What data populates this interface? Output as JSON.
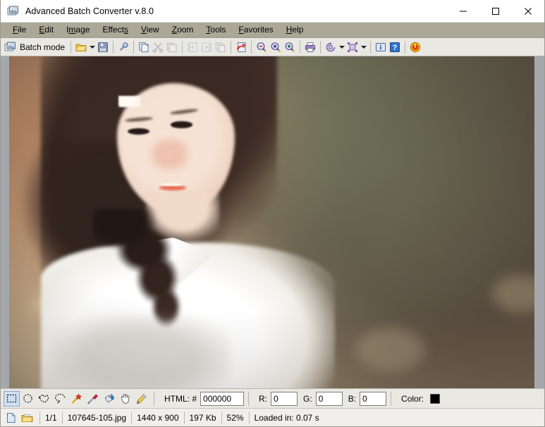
{
  "window": {
    "title": "Advanced Batch Converter v.8.0",
    "app_icon": "app-image-stack-icon",
    "controls": {
      "minimize": "minimize-icon",
      "maximize": "maximize-icon",
      "close": "close-icon"
    }
  },
  "menubar": {
    "items": [
      {
        "label": "File",
        "mnemonic": "F"
      },
      {
        "label": "Edit",
        "mnemonic": "E"
      },
      {
        "label": "Image",
        "mnemonic": "m"
      },
      {
        "label": "Effects",
        "mnemonic": "s"
      },
      {
        "label": "View",
        "mnemonic": "V"
      },
      {
        "label": "Zoom",
        "mnemonic": "Z"
      },
      {
        "label": "Tools",
        "mnemonic": "T"
      },
      {
        "label": "Favorites",
        "mnemonic": "F"
      },
      {
        "label": "Help",
        "mnemonic": "H"
      }
    ]
  },
  "toolbar": {
    "batch_mode_label": "Batch mode",
    "buttons": [
      {
        "name": "batch-mode-button",
        "icon": "image-stack-icon",
        "label": "Batch mode",
        "enabled": true
      },
      {
        "name": "open-file-button",
        "icon": "open-folder-icon",
        "label": "Open",
        "enabled": true
      },
      {
        "name": "open-dropdown",
        "icon": "chevron-down-icon",
        "label": "",
        "enabled": true
      },
      {
        "name": "save-button",
        "icon": "floppy-save-icon",
        "label": "Save",
        "enabled": true
      },
      {
        "name": "properties-button",
        "icon": "magnifier-info-icon",
        "label": "Properties",
        "enabled": true
      },
      {
        "name": "copy-button",
        "icon": "copy-icon",
        "label": "Copy",
        "enabled": true
      },
      {
        "name": "cut-button",
        "icon": "scissors-icon",
        "label": "Cut",
        "enabled": false
      },
      {
        "name": "paste-button",
        "icon": "paste-icon",
        "label": "Paste",
        "enabled": false
      },
      {
        "name": "previous-image",
        "icon": "prev-image-icon",
        "label": "Previous",
        "enabled": false
      },
      {
        "name": "next-image",
        "icon": "next-image-icon",
        "label": "Next",
        "enabled": false
      },
      {
        "name": "thumbnails-button",
        "icon": "thumbnails-icon",
        "label": "Thumbnails",
        "enabled": false
      },
      {
        "name": "undo-redo-button",
        "icon": "red-arrow-page-icon",
        "label": "Undo",
        "enabled": true
      },
      {
        "name": "zoom-out-button",
        "icon": "zoom-out-icon",
        "label": "Zoom out",
        "enabled": true
      },
      {
        "name": "zoom-fit-button",
        "icon": "zoom-actual-icon",
        "label": "Actual size",
        "enabled": true
      },
      {
        "name": "zoom-in-button",
        "icon": "zoom-in-icon",
        "label": "Zoom in",
        "enabled": true
      },
      {
        "name": "print-button",
        "icon": "printer-icon",
        "label": "Print",
        "enabled": true
      },
      {
        "name": "rotate-button",
        "icon": "rotate-icon",
        "label": "Rotate",
        "enabled": true
      },
      {
        "name": "rotate-dropdown",
        "icon": "chevron-down-icon",
        "label": "",
        "enabled": true
      },
      {
        "name": "resize-button",
        "icon": "resize-icon",
        "label": "Resize",
        "enabled": true
      },
      {
        "name": "resize-dropdown",
        "icon": "chevron-down-icon",
        "label": "",
        "enabled": true
      },
      {
        "name": "info-button",
        "icon": "info-icon",
        "label": "Info",
        "enabled": true
      },
      {
        "name": "help-button",
        "icon": "help-question-icon",
        "label": "Help",
        "enabled": true
      },
      {
        "name": "exit-button",
        "icon": "power-exit-icon",
        "label": "Exit",
        "enabled": true
      }
    ]
  },
  "tool_strip": {
    "tools": [
      {
        "name": "rect-select-tool",
        "icon": "rect-select-icon",
        "active": true
      },
      {
        "name": "ellipse-select-tool",
        "icon": "ellipse-select-icon",
        "active": false
      },
      {
        "name": "polygon-select-tool",
        "icon": "polygon-select-icon",
        "active": false
      },
      {
        "name": "lasso-select-tool",
        "icon": "lasso-select-icon",
        "active": false
      },
      {
        "name": "magic-wand-tool",
        "icon": "magic-wand-icon",
        "active": false
      },
      {
        "name": "eyedropper-tool",
        "icon": "eyedropper-icon",
        "active": false
      },
      {
        "name": "paint-bucket-tool",
        "icon": "paint-bucket-icon",
        "active": false
      },
      {
        "name": "pan-hand-tool",
        "icon": "hand-icon",
        "active": false
      },
      {
        "name": "pencil-tool",
        "icon": "pencil-icon",
        "active": false
      }
    ],
    "html_label": "HTML: #",
    "html_value": "000000",
    "r_label": "R:",
    "r_value": "0",
    "g_label": "G:",
    "g_value": "0",
    "b_label": "B:",
    "b_value": "0",
    "color_label": "Color:",
    "color_value": "#000000"
  },
  "statusbar": {
    "icons": [
      {
        "name": "new-image-icon"
      },
      {
        "name": "open-folder-icon"
      }
    ],
    "page_counter": "1/1",
    "filename": "107645-105.jpg",
    "dimensions": "1440 x 900",
    "filesize": "197 Kb",
    "zoom": "52%",
    "load_time": "Loaded in: 0.07 s"
  },
  "theme": {
    "menubar_bg": "#ABA898",
    "toolbar_bg": "#E9E8E3",
    "statusbar_bg": "#F0EFEC",
    "viewer_bg": "#9CA0A6",
    "accent_select": "#CFE0F2",
    "text": "#000000"
  },
  "image_preview": {
    "description": "Portrait photograph of a smiling young woman in a white shirt with a braid, blurred bokeh foliage background",
    "alt_name": "image-canvas"
  }
}
